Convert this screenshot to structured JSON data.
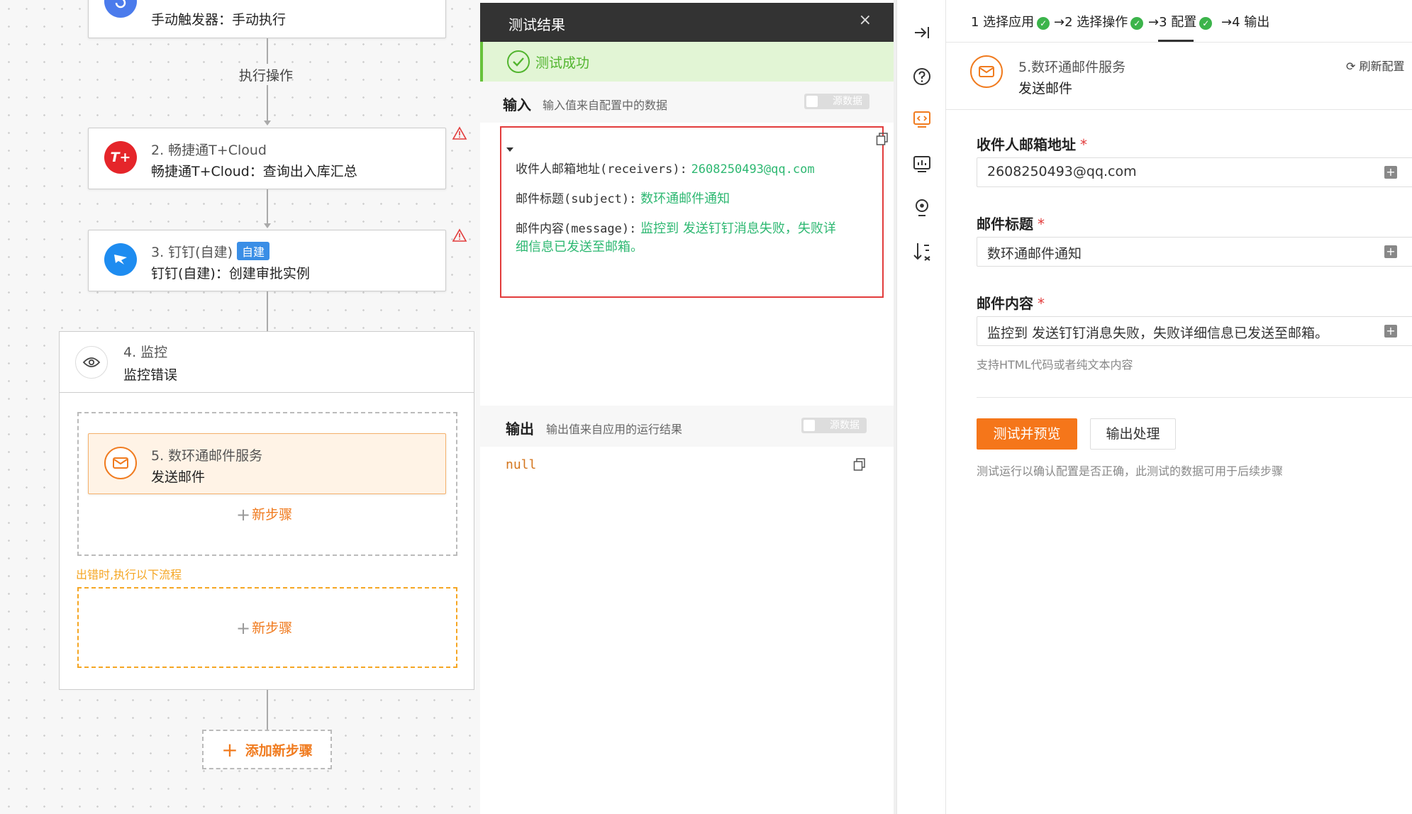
{
  "flow": {
    "node1": {
      "desc": "手动触发器：手动执行"
    },
    "exec_label": "执行操作",
    "node2": {
      "title": "2. 畅捷通T+Cloud",
      "desc": "畅捷通T+Cloud：查询出入库汇总",
      "logo_text": "T+"
    },
    "node3": {
      "title": "3. 钉钉(自建)",
      "tag": "自建",
      "desc": "钉钉(自建)：创建审批实例"
    },
    "node4": {
      "title": "4. 监控",
      "desc": "监控错误"
    },
    "node5": {
      "title": "5. 数环通邮件服务",
      "desc": "发送邮件"
    },
    "new_step": "新步骤",
    "error_label": "出错时,执行以下流程",
    "new_step_error": "新步骤",
    "add_step": "添加新步骤"
  },
  "result": {
    "title": "测试结果",
    "close": "×",
    "success": "测试成功",
    "input": {
      "heading": "输入",
      "sub": "输入值来自配置中的数据",
      "toggle": "源数据"
    },
    "fields": [
      {
        "key": "收件人邮箱地址(receivers):",
        "value": "2608250493@qq.com"
      },
      {
        "key": "邮件标题(subject):",
        "value": "数环通邮件通知"
      },
      {
        "key": "邮件内容(message):",
        "value": "监控到 发送钉钉消息失败，失败详",
        "value2": "细信息已发送至邮箱。"
      }
    ],
    "output": {
      "heading": "输出",
      "sub": "输出值来自应用的运行结果",
      "toggle": "源数据",
      "value": "null"
    }
  },
  "config": {
    "steps": [
      {
        "label": "1 选择应用"
      },
      {
        "label": "→2 选择操作"
      },
      {
        "label": "→3 配置"
      },
      {
        "label": "→4 输出"
      }
    ],
    "service": {
      "name": "5.数环通邮件服务",
      "action": "发送邮件",
      "refresh": "刷新配置"
    },
    "receivers": {
      "label": "收件人邮箱地址",
      "value": "2608250493@qq.com"
    },
    "subject": {
      "label": "邮件标题",
      "value": "数环通邮件通知"
    },
    "message": {
      "label": "邮件内容",
      "value": "监控到 发送钉钉消息失败，失败详细信息已发送至邮箱。",
      "hint": "支持HTML代码或者纯文本内容"
    },
    "required_mark": "*",
    "test_button": "测试并预览",
    "output_button": "输出处理",
    "test_hint": "测试运行以确认配置是否正确，此测试的数据可用于后续步骤"
  },
  "colors": {
    "accent": "#f5761a",
    "success": "#52b52f",
    "value": "#2eb872",
    "error": "#e23c3c"
  }
}
